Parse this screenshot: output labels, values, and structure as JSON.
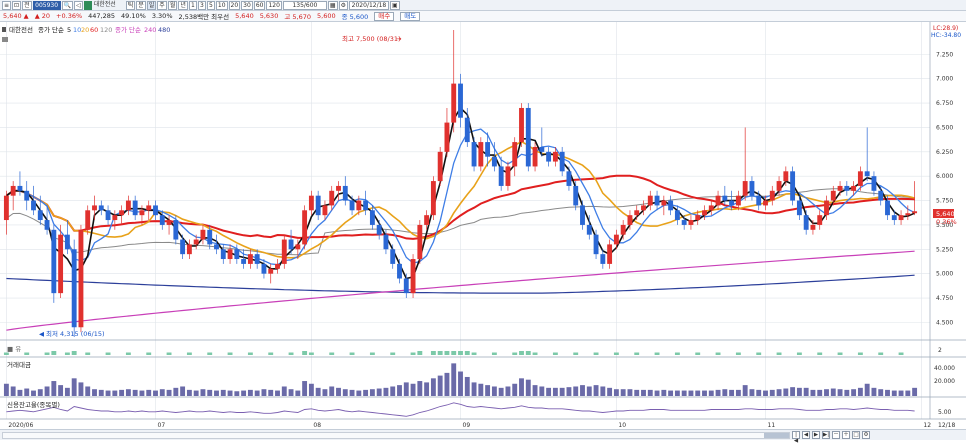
{
  "toolbar": {
    "code": "005930",
    "stock_name": "대한전선",
    "periods": [
      "틱",
      "분",
      "일",
      "주",
      "월",
      "년"
    ],
    "numbers": [
      "1",
      "3",
      "5",
      "10",
      "20",
      "30",
      "60",
      "120"
    ],
    "count": "135/600",
    "date": "2020/12/18",
    "buy": "매수",
    "sell": "매도"
  },
  "infobar": {
    "price": "5,640",
    "change": "20",
    "change_pct": "+0.36%",
    "volume": "447,285",
    "vol_ratio": "49.10%",
    "ratio2": "3.30%",
    "amount": "2,538백만",
    "label_sh": "최우선",
    "open_l": "시",
    "open": "5,640",
    "open2": "5,630",
    "high_l": "고",
    "high": "5,670",
    "low_l": "저",
    "low": "5,600",
    "close_l": "종",
    "close": "5,600"
  },
  "legend": {
    "main": "대한전선",
    "ma_label": "종가 단순",
    "ma1": "5",
    "ma2": "10",
    "ma3": "20",
    "ma4": "60",
    "ma5": "120",
    "ma6_label": "종가 단순",
    "ma6": "240",
    "ma7": "480",
    "vol_title": "거래대금",
    "credit_title": "신용잔고율(종목별)",
    "right1": "LC:28.9)",
    "right2": "HC:-34.80"
  },
  "annotations": {
    "high": "최고 7,500 (08/31)",
    "low": "최저 4,315 (06/15)"
  },
  "badges": {
    "price": "5,640",
    "change": "0.36%"
  },
  "axis": {
    "price_ticks": [
      "7.250",
      "7.000",
      "6.750",
      "6.500",
      "6.250",
      "6.000",
      "5.750",
      "5.500",
      "5.250",
      "5.000",
      "4.750",
      "4.500"
    ],
    "vol_ticks": [
      "40.000",
      "20.000"
    ],
    "credit_ticks": [
      "5.00"
    ],
    "sub_tick": "2",
    "dates": [
      {
        "label": "2020/06",
        "at": 0
      },
      {
        "label": "07",
        "at": 22
      },
      {
        "label": "08",
        "at": 45
      },
      {
        "label": "09",
        "at": 67
      },
      {
        "label": "10",
        "at": 90
      },
      {
        "label": "11",
        "at": 112
      },
      {
        "label": "12",
        "at": 135
      }
    ],
    "end_date": "12/18"
  },
  "colors": {
    "up": "#e0312e",
    "down": "#2a67d4",
    "ma5": "#111111",
    "ma10": "#3f7ee6",
    "ma20": "#e8a21a",
    "ma60": "#e01f1f",
    "ma120": "#8a8a8a",
    "ma240": "#c83fb8",
    "ma480": "#2c3f9a",
    "grid": "#dfe4ea"
  },
  "chart_data": {
    "type": "candlestick",
    "y_range": [
      4350,
      7500
    ],
    "candles": [
      [
        5550,
        5850,
        5400,
        5800
      ],
      [
        5800,
        5950,
        5650,
        5900
      ],
      [
        5900,
        6050,
        5800,
        5850
      ],
      [
        5850,
        5950,
        5650,
        5750
      ],
      [
        5750,
        5900,
        5600,
        5650
      ],
      [
        5650,
        5800,
        5500,
        5550
      ],
      [
        5550,
        5700,
        5400,
        5450
      ],
      [
        5450,
        5500,
        4700,
        4800
      ],
      [
        4800,
        5500,
        4750,
        5400
      ],
      [
        5400,
        5550,
        5200,
        5250
      ],
      [
        5250,
        5350,
        4350,
        4450
      ],
      [
        4450,
        5500,
        4400,
        5450
      ],
      [
        5450,
        5700,
        5400,
        5650
      ],
      [
        5650,
        5800,
        5550,
        5700
      ],
      [
        5700,
        5750,
        5600,
        5650
      ],
      [
        5650,
        5700,
        5500,
        5550
      ],
      [
        5550,
        5650,
        5450,
        5600
      ],
      [
        5600,
        5700,
        5500,
        5650
      ],
      [
        5650,
        5800,
        5600,
        5750
      ],
      [
        5750,
        5800,
        5550,
        5600
      ],
      [
        5600,
        5700,
        5500,
        5650
      ],
      [
        5650,
        5750,
        5550,
        5700
      ],
      [
        5700,
        5750,
        5550,
        5600
      ],
      [
        5600,
        5650,
        5450,
        5500
      ],
      [
        5500,
        5600,
        5400,
        5550
      ],
      [
        5550,
        5600,
        5300,
        5350
      ],
      [
        5350,
        5400,
        5150,
        5200
      ],
      [
        5200,
        5350,
        5150,
        5300
      ],
      [
        5300,
        5400,
        5250,
        5350
      ],
      [
        5350,
        5500,
        5300,
        5450
      ],
      [
        5450,
        5500,
        5250,
        5300
      ],
      [
        5300,
        5400,
        5200,
        5250
      ],
      [
        5250,
        5300,
        5100,
        5150
      ],
      [
        5150,
        5300,
        5100,
        5250
      ],
      [
        5250,
        5300,
        5100,
        5150
      ],
      [
        5150,
        5250,
        5050,
        5100
      ],
      [
        5100,
        5250,
        5050,
        5200
      ],
      [
        5200,
        5250,
        5050,
        5100
      ],
      [
        5100,
        5150,
        4950,
        5000
      ],
      [
        5000,
        5100,
        4900,
        5050
      ],
      [
        5050,
        5150,
        5000,
        5100
      ],
      [
        5100,
        5400,
        5050,
        5350
      ],
      [
        5350,
        5450,
        5200,
        5250
      ],
      [
        5250,
        5350,
        5150,
        5300
      ],
      [
        5300,
        5700,
        5250,
        5650
      ],
      [
        5650,
        5850,
        5600,
        5800
      ],
      [
        5800,
        5850,
        5550,
        5600
      ],
      [
        5600,
        5750,
        5550,
        5700
      ],
      [
        5700,
        5900,
        5650,
        5850
      ],
      [
        5850,
        5950,
        5750,
        5900
      ],
      [
        5900,
        6000,
        5700,
        5750
      ],
      [
        5750,
        5800,
        5600,
        5650
      ],
      [
        5650,
        5800,
        5600,
        5750
      ],
      [
        5750,
        5850,
        5600,
        5650
      ],
      [
        5650,
        5700,
        5450,
        5500
      ],
      [
        5500,
        5550,
        5350,
        5400
      ],
      [
        5400,
        5450,
        5200,
        5250
      ],
      [
        5250,
        5300,
        5050,
        5100
      ],
      [
        5100,
        5150,
        4900,
        4950
      ],
      [
        4950,
        5000,
        4750,
        4800
      ],
      [
        4800,
        5200,
        4750,
        5150
      ],
      [
        5150,
        5550,
        5100,
        5500
      ],
      [
        5500,
        5650,
        5450,
        5600
      ],
      [
        5600,
        6000,
        5550,
        5950
      ],
      [
        5950,
        6300,
        5900,
        6250
      ],
      [
        6250,
        6700,
        6200,
        6550
      ],
      [
        6550,
        7500,
        6450,
        6950
      ],
      [
        6950,
        7050,
        6500,
        6600
      ],
      [
        6600,
        6700,
        6300,
        6350
      ],
      [
        6350,
        6400,
        6050,
        6100
      ],
      [
        6100,
        6400,
        6050,
        6350
      ],
      [
        6350,
        6450,
        6100,
        6200
      ],
      [
        6200,
        6350,
        6050,
        6100
      ],
      [
        6100,
        6200,
        5850,
        5900
      ],
      [
        5900,
        6150,
        5850,
        6100
      ],
      [
        6100,
        6400,
        6000,
        6350
      ],
      [
        6350,
        6750,
        6300,
        6700
      ],
      [
        6700,
        6750,
        6050,
        6100
      ],
      [
        6100,
        6350,
        6050,
        6300
      ],
      [
        6300,
        6500,
        6200,
        6250
      ],
      [
        6250,
        6300,
        6100,
        6150
      ],
      [
        6150,
        6300,
        6100,
        6250
      ],
      [
        6250,
        6300,
        6000,
        6050
      ],
      [
        6050,
        6100,
        5850,
        5900
      ],
      [
        5900,
        5950,
        5650,
        5700
      ],
      [
        5700,
        5750,
        5450,
        5500
      ],
      [
        5500,
        5600,
        5350,
        5400
      ],
      [
        5400,
        5450,
        5150,
        5200
      ],
      [
        5200,
        5250,
        5050,
        5100
      ],
      [
        5100,
        5350,
        5050,
        5300
      ],
      [
        5300,
        5450,
        5250,
        5400
      ],
      [
        5400,
        5550,
        5350,
        5500
      ],
      [
        5500,
        5650,
        5450,
        5600
      ],
      [
        5600,
        5700,
        5550,
        5650
      ],
      [
        5650,
        5750,
        5600,
        5700
      ],
      [
        5700,
        5850,
        5650,
        5800
      ],
      [
        5800,
        5850,
        5650,
        5700
      ],
      [
        5700,
        5800,
        5600,
        5750
      ],
      [
        5750,
        5800,
        5600,
        5650
      ],
      [
        5650,
        5700,
        5500,
        5550
      ],
      [
        5550,
        5600,
        5450,
        5500
      ],
      [
        5500,
        5600,
        5450,
        5550
      ],
      [
        5550,
        5650,
        5500,
        5600
      ],
      [
        5600,
        5700,
        5550,
        5650
      ],
      [
        5650,
        5750,
        5600,
        5700
      ],
      [
        5700,
        5850,
        5650,
        5800
      ],
      [
        5800,
        5900,
        5700,
        5750
      ],
      [
        5750,
        5850,
        5650,
        5700
      ],
      [
        5700,
        5850,
        5650,
        5800
      ],
      [
        5800,
        6500,
        5750,
        5950
      ],
      [
        5950,
        6000,
        5750,
        5800
      ],
      [
        5800,
        5850,
        5650,
        5700
      ],
      [
        5700,
        5800,
        5650,
        5750
      ],
      [
        5750,
        5900,
        5700,
        5850
      ],
      [
        5850,
        6000,
        5800,
        5950
      ],
      [
        5950,
        6100,
        5900,
        6050
      ],
      [
        6050,
        6100,
        5700,
        5750
      ],
      [
        5750,
        5800,
        5550,
        5600
      ],
      [
        5600,
        5650,
        5400,
        5450
      ],
      [
        5450,
        5550,
        5400,
        5500
      ],
      [
        5500,
        5650,
        5450,
        5600
      ],
      [
        5600,
        5800,
        5550,
        5750
      ],
      [
        5750,
        5900,
        5700,
        5850
      ],
      [
        5850,
        5950,
        5800,
        5900
      ],
      [
        5900,
        5950,
        5800,
        5850
      ],
      [
        5850,
        5950,
        5800,
        5900
      ],
      [
        5900,
        6100,
        5850,
        6050
      ],
      [
        6050,
        6500,
        5950,
        6000
      ],
      [
        6000,
        6050,
        5800,
        5850
      ],
      [
        5850,
        5900,
        5700,
        5750
      ],
      [
        5750,
        5800,
        5550,
        5600
      ],
      [
        5600,
        5650,
        5500,
        5550
      ],
      [
        5550,
        5650,
        5500,
        5600
      ],
      [
        5600,
        5700,
        5550,
        5620
      ],
      [
        5620,
        5950,
        5600,
        5640
      ]
    ],
    "volumes": [
      18,
      14,
      9,
      11,
      8,
      10,
      14,
      22,
      16,
      12,
      26,
      20,
      14,
      10,
      9,
      8,
      8,
      9,
      10,
      9,
      8,
      9,
      8,
      10,
      9,
      12,
      14,
      9,
      8,
      10,
      9,
      8,
      9,
      8,
      7,
      8,
      9,
      8,
      10,
      9,
      8,
      14,
      10,
      8,
      22,
      18,
      12,
      10,
      14,
      12,
      10,
      9,
      8,
      9,
      10,
      11,
      12,
      14,
      16,
      20,
      18,
      22,
      20,
      26,
      30,
      34,
      48,
      36,
      28,
      20,
      18,
      16,
      14,
      12,
      14,
      18,
      26,
      24,
      16,
      14,
      12,
      12,
      12,
      13,
      14,
      16,
      14,
      16,
      14,
      12,
      10,
      10,
      10,
      9,
      9,
      9,
      8,
      9,
      8,
      8,
      8,
      8,
      8,
      8,
      8,
      9,
      10,
      9,
      9,
      16,
      10,
      9,
      8,
      9,
      10,
      11,
      13,
      12,
      12,
      9,
      9,
      10,
      11,
      10,
      9,
      10,
      12,
      18,
      12,
      10,
      9,
      8,
      8,
      8,
      12
    ],
    "credit": [
      5.2,
      5.3,
      5.4,
      5.3,
      5.2,
      5.4,
      5.6,
      5.8,
      5.5,
      5.3,
      5.9,
      5.7,
      5.5,
      5.4,
      5.3,
      5.3,
      5.2,
      5.2,
      5.3,
      5.2,
      5.3,
      5.2,
      5.2,
      5.3,
      5.2,
      5.1,
      5.2,
      5.3,
      5.2,
      5.2,
      5.3,
      5.2,
      5.1,
      5.2,
      5.1,
      5.1,
      5.2,
      5.1,
      5.0,
      5.0,
      5.1,
      5.3,
      5.2,
      5.1,
      5.5,
      5.6,
      5.4,
      5.3,
      5.4,
      5.5,
      5.3,
      5.2,
      5.3,
      5.2,
      5.1,
      5.0,
      4.9,
      4.8,
      4.7,
      4.6,
      4.8,
      5.1,
      5.3,
      5.6,
      5.9,
      6.1,
      6.4,
      6.2,
      5.9,
      5.8,
      5.9,
      5.8,
      5.7,
      5.6,
      5.7,
      5.8,
      6.0,
      5.8,
      5.7,
      5.7,
      5.6,
      5.6,
      5.6,
      5.5,
      5.4,
      5.3,
      5.3,
      5.2,
      5.1,
      5.2,
      5.3,
      5.3,
      5.4,
      5.4,
      5.4,
      5.5,
      5.5,
      5.5,
      5.4,
      5.4,
      5.4,
      5.4,
      5.4,
      5.4,
      5.5,
      5.5,
      5.5,
      5.5,
      5.5,
      5.6,
      5.6,
      5.5,
      5.5,
      5.5,
      5.6,
      5.6,
      5.6,
      5.5,
      5.4,
      5.4,
      5.4,
      5.5,
      5.5,
      5.6,
      5.6,
      5.5,
      5.6,
      5.7,
      5.6,
      5.5,
      5.5,
      5.4,
      5.4,
      5.4,
      5.3
    ]
  }
}
